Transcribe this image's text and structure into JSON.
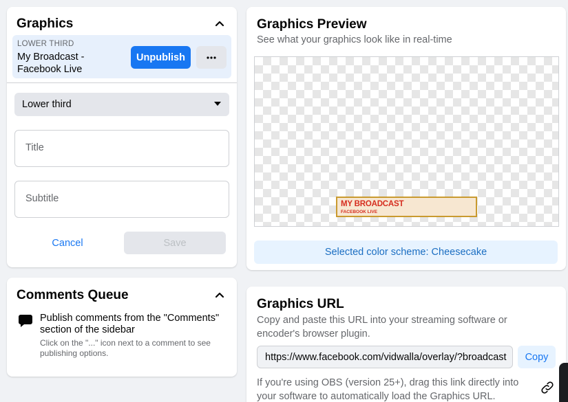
{
  "graphics": {
    "title": "Graphics",
    "item": {
      "kind": "LOWER THIRD",
      "name": "My Broadcast - Facebook Live",
      "unpublish_label": "Unpublish",
      "more_label": "···"
    },
    "type_select": {
      "value": "Lower third"
    },
    "title_field": {
      "placeholder": "Title",
      "value": ""
    },
    "subtitle_field": {
      "placeholder": "Subtitle",
      "value": ""
    },
    "cancel_label": "Cancel",
    "save_label": "Save"
  },
  "comments_queue": {
    "title": "Comments Queue",
    "main_text": "Publish comments from the \"Comments\" section of the sidebar",
    "sub_text": "Click on the \"...\" icon next to a comment to see publishing options."
  },
  "preview": {
    "title": "Graphics Preview",
    "subtitle": "See what your graphics look like in real-time",
    "overlay": {
      "title": "MY BROADCAST",
      "subtitle": "FACEBOOK LIVE"
    },
    "scheme_text": "Selected color scheme: Cheesecake"
  },
  "url": {
    "title": "Graphics URL",
    "description": "Copy and paste this URL into your streaming software or encoder's browser plugin.",
    "value": "https://www.facebook.com/vidwalla/overlay/?broadcast",
    "copy_label": "Copy",
    "obs_note": "If you're using OBS (version 25+), drag this link directly into your software to automatically load the Graphics URL."
  },
  "colors": {
    "accent": "#1877f2",
    "overlay_background": "#f7e7d1",
    "overlay_border": "#c99a2f",
    "overlay_text": "#d62d1f"
  }
}
